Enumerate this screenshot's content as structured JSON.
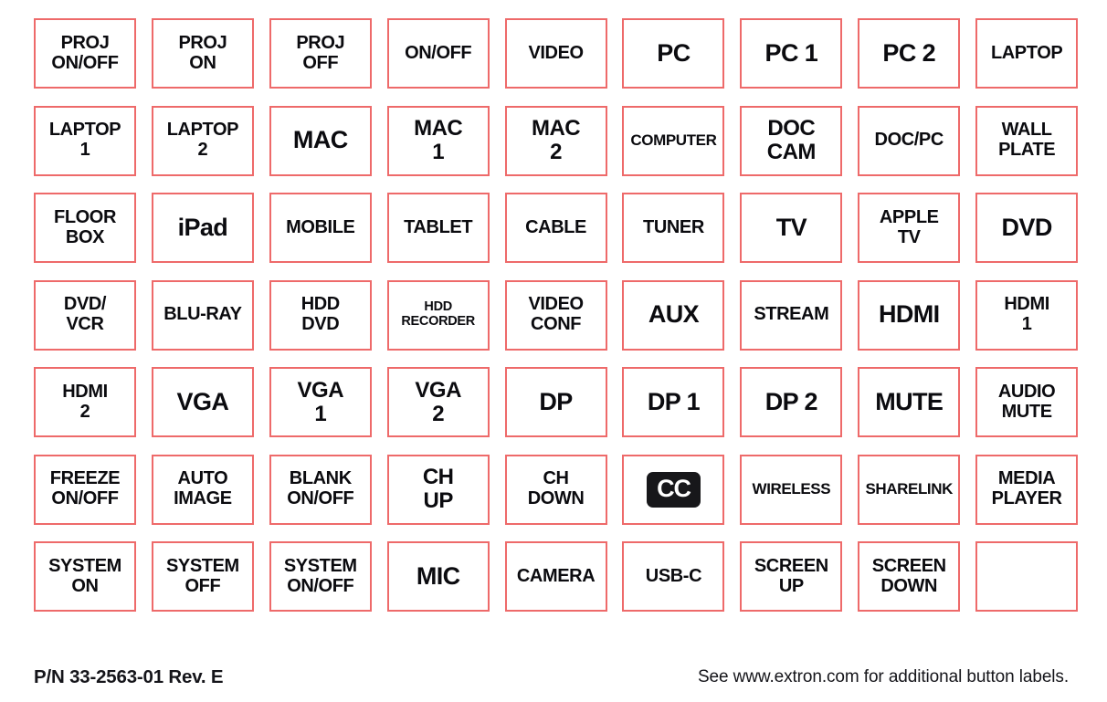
{
  "sheet": {
    "border_color": "#ee6a6a",
    "text_color": "#0b0b0f",
    "background_color": "#ffffff",
    "columns": 9,
    "rows": 7
  },
  "buttons": [
    {
      "id": "proj-on-off",
      "label": "PROJ\nON/OFF",
      "size": "md"
    },
    {
      "id": "proj-on",
      "label": "PROJ\nON",
      "size": "md"
    },
    {
      "id": "proj-off",
      "label": "PROJ\nOFF",
      "size": "md"
    },
    {
      "id": "on-off",
      "label": "ON/OFF",
      "size": "md"
    },
    {
      "id": "video",
      "label": "VIDEO",
      "size": "md"
    },
    {
      "id": "pc",
      "label": "PC",
      "size": "xl"
    },
    {
      "id": "pc-1",
      "label": "PC 1",
      "size": "xl"
    },
    {
      "id": "pc-2",
      "label": "PC 2",
      "size": "xl"
    },
    {
      "id": "laptop",
      "label": "LAPTOP",
      "size": "md"
    },
    {
      "id": "laptop-1",
      "label": "LAPTOP\n1",
      "size": "md"
    },
    {
      "id": "laptop-2",
      "label": "LAPTOP\n2",
      "size": "md"
    },
    {
      "id": "mac",
      "label": "MAC",
      "size": "xl"
    },
    {
      "id": "mac-1",
      "label": "MAC\n1",
      "size": "lg"
    },
    {
      "id": "mac-2",
      "label": "MAC\n2",
      "size": "lg"
    },
    {
      "id": "computer",
      "label": "COMPUTER",
      "size": "sm"
    },
    {
      "id": "doc-cam",
      "label": "DOC\nCAM",
      "size": "lg"
    },
    {
      "id": "doc-pc",
      "label": "DOC/PC",
      "size": "md"
    },
    {
      "id": "wall-plate",
      "label": "WALL\nPLATE",
      "size": "md"
    },
    {
      "id": "floor-box",
      "label": "FLOOR\nBOX",
      "size": "md"
    },
    {
      "id": "ipad",
      "label": "iPad",
      "size": "xl"
    },
    {
      "id": "mobile",
      "label": "MOBILE",
      "size": "md"
    },
    {
      "id": "tablet",
      "label": "TABLET",
      "size": "md"
    },
    {
      "id": "cable",
      "label": "CABLE",
      "size": "md"
    },
    {
      "id": "tuner",
      "label": "TUNER",
      "size": "md"
    },
    {
      "id": "tv",
      "label": "TV",
      "size": "xl"
    },
    {
      "id": "apple-tv",
      "label": "APPLE\nTV",
      "size": "md"
    },
    {
      "id": "dvd",
      "label": "DVD",
      "size": "xl"
    },
    {
      "id": "dvd-vcr",
      "label": "DVD/\nVCR",
      "size": "md"
    },
    {
      "id": "blu-ray",
      "label": "BLU-RAY",
      "size": "md"
    },
    {
      "id": "hdd-dvd",
      "label": "HDD\nDVD",
      "size": "md"
    },
    {
      "id": "hdd-recorder",
      "label": "HDD\nRECORDER",
      "size": "xs"
    },
    {
      "id": "video-conf",
      "label": "VIDEO\nCONF",
      "size": "md"
    },
    {
      "id": "aux",
      "label": "AUX",
      "size": "xl"
    },
    {
      "id": "stream",
      "label": "STREAM",
      "size": "md"
    },
    {
      "id": "hdmi",
      "label": "HDMI",
      "size": "xl"
    },
    {
      "id": "hdmi-1",
      "label": "HDMI\n1",
      "size": "md"
    },
    {
      "id": "hdmi-2",
      "label": "HDMI\n2",
      "size": "md"
    },
    {
      "id": "vga",
      "label": "VGA",
      "size": "xl"
    },
    {
      "id": "vga-1",
      "label": "VGA\n1",
      "size": "lg"
    },
    {
      "id": "vga-2",
      "label": "VGA\n2",
      "size": "lg"
    },
    {
      "id": "dp",
      "label": "DP",
      "size": "xl"
    },
    {
      "id": "dp-1",
      "label": "DP 1",
      "size": "xl"
    },
    {
      "id": "dp-2",
      "label": "DP 2",
      "size": "xl"
    },
    {
      "id": "mute",
      "label": "MUTE",
      "size": "xl"
    },
    {
      "id": "audio-mute",
      "label": "AUDIO\nMUTE",
      "size": "md"
    },
    {
      "id": "freeze-on-off",
      "label": "FREEZE\nON/OFF",
      "size": "md"
    },
    {
      "id": "auto-image",
      "label": "AUTO\nIMAGE",
      "size": "md"
    },
    {
      "id": "blank-on-off",
      "label": "BLANK\nON/OFF",
      "size": "md"
    },
    {
      "id": "ch-up",
      "label": "CH\nUP",
      "size": "lg"
    },
    {
      "id": "ch-down",
      "label": "CH\nDOWN",
      "size": "md"
    },
    {
      "id": "closed-caption",
      "label": "CC",
      "size": "md",
      "style": "cc-badge"
    },
    {
      "id": "wireless",
      "label": "WIRELESS",
      "size": "sm"
    },
    {
      "id": "sharelink",
      "label": "SHARELINK",
      "size": "sm"
    },
    {
      "id": "media-player",
      "label": "MEDIA\nPLAYER",
      "size": "md"
    },
    {
      "id": "system-on",
      "label": "SYSTEM\nON",
      "size": "md"
    },
    {
      "id": "system-off",
      "label": "SYSTEM\nOFF",
      "size": "md"
    },
    {
      "id": "system-on-off",
      "label": "SYSTEM\nON/OFF",
      "size": "md"
    },
    {
      "id": "mic",
      "label": "MIC",
      "size": "xl"
    },
    {
      "id": "camera",
      "label": "CAMERA",
      "size": "md"
    },
    {
      "id": "usb-c",
      "label": "USB-C",
      "size": "md"
    },
    {
      "id": "screen-up",
      "label": "SCREEN\nUP",
      "size": "md"
    },
    {
      "id": "screen-down",
      "label": "SCREEN\nDOWN",
      "size": "md"
    },
    {
      "id": "blank",
      "label": "",
      "size": "md",
      "style": "blank"
    }
  ],
  "footer": {
    "part_number": "P/N 33-2563-01 Rev. E",
    "note": "See www.extron.com for additional button labels."
  }
}
